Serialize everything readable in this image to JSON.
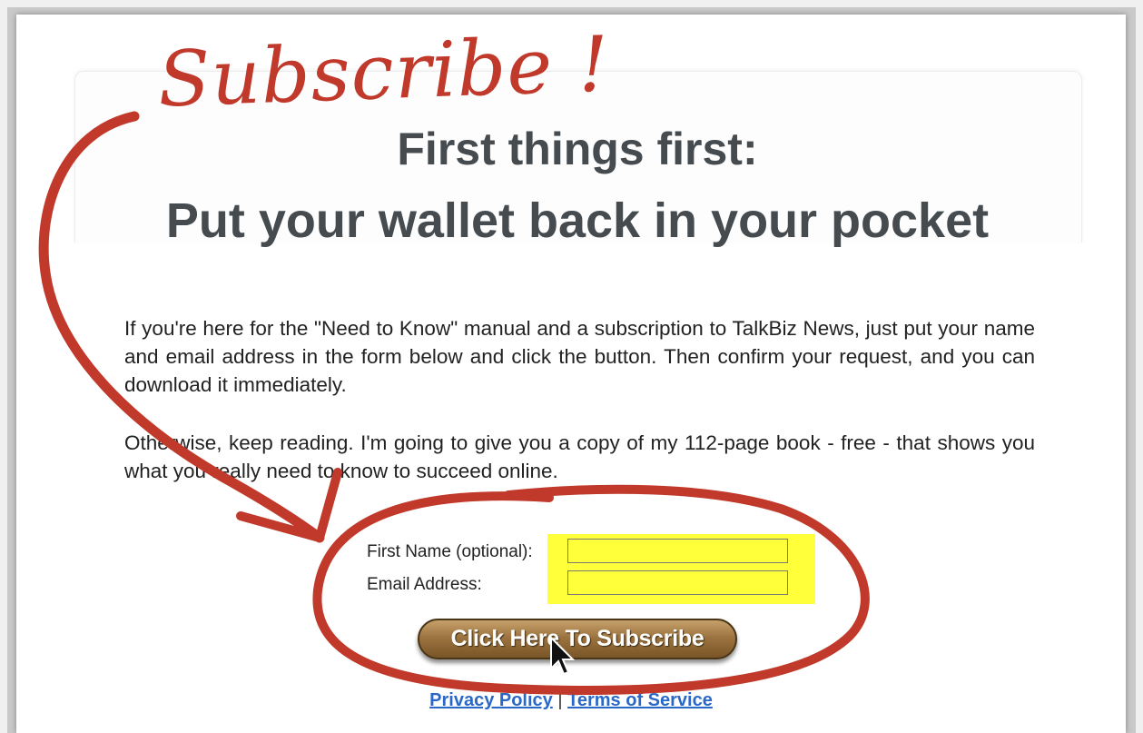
{
  "annotation": {
    "handwritten_text": "Subscribe !",
    "ink_color": "#c0392b"
  },
  "header": {
    "line1": "First things first:",
    "line2": "Put your wallet back in your pocket"
  },
  "body": {
    "paragraph1": "If you're here for the \"Need to Know\" manual and a subscription to TalkBiz News, just put your name and email address in the form below and click the button. Then confirm your request, and you can download it immediately.",
    "paragraph2": "Otherwise, keep reading. I'm going to give you a copy of my 112-page book - free - that shows you what you really need to know to succeed online."
  },
  "form": {
    "first_name_label": "First Name (optional):",
    "first_name_value": "",
    "email_label": "Email Address:",
    "email_value": "",
    "highlight_color": "#ffff3a",
    "submit_label": "Click Here To Subscribe"
  },
  "footer": {
    "privacy_label": "Privacy Policy",
    "separator": "|",
    "terms_label": "Terms of Service"
  }
}
